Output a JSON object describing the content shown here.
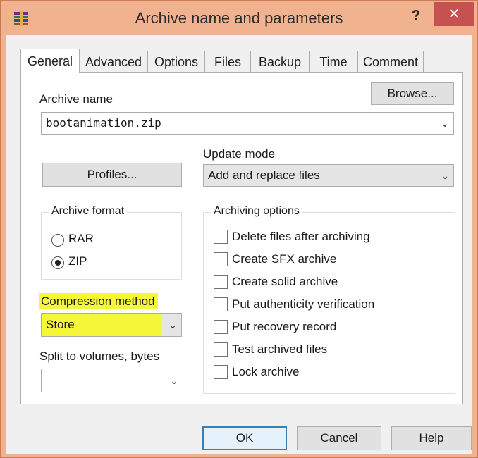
{
  "window": {
    "title": "Archive name and parameters",
    "help_label": "?",
    "close_label": "✕"
  },
  "tabs": [
    "General",
    "Advanced",
    "Options",
    "Files",
    "Backup",
    "Time",
    "Comment"
  ],
  "general": {
    "archive_name_label": "Archive name",
    "browse_label": "Browse...",
    "archive_name_value": "bootanimation.zip",
    "update_mode_label": "Update mode",
    "update_mode_value": "Add and replace files",
    "profiles_label": "Profiles...",
    "archive_format": {
      "title": "Archive format",
      "options": [
        "RAR",
        "ZIP"
      ],
      "selected": "ZIP"
    },
    "archiving_options": {
      "title": "Archiving options",
      "items": [
        "Delete files after archiving",
        "Create SFX archive",
        "Create solid archive",
        "Put authenticity verification",
        "Put recovery record",
        "Test archived files",
        "Lock archive"
      ]
    },
    "compression_method_label": "Compression method",
    "compression_method_value": "Store",
    "split_label": "Split to volumes, bytes",
    "split_value": ""
  },
  "footer": {
    "ok_label": "OK",
    "cancel_label": "Cancel",
    "help_label": "Help"
  },
  "colors": {
    "titlebar": "#f0b28f",
    "close_button": "#c75050",
    "highlight": "#f7f73a",
    "default_button_border": "#3c7fb1"
  }
}
